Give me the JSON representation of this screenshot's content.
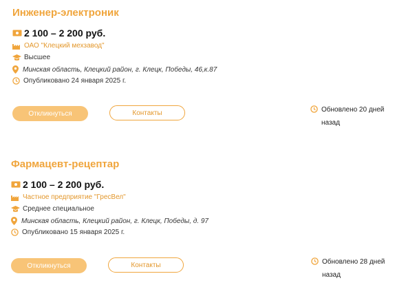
{
  "colors": {
    "accent": "#f0a53c",
    "link": "#e3972b",
    "button_fill": "#f8c477"
  },
  "vacancies": [
    {
      "title": "Инженер-электроник",
      "salary": "2 100 – 2 200 руб.",
      "company": "ОАО \"Клецкий мехзавод\"",
      "education": "Высшее",
      "address": "Минская область, Клецкий район, г. Клецк, Победы, 46,к.87",
      "published": "Опубликовано 24 января 2025 г.",
      "respond_label": "Откликнуться",
      "contacts_label": "Контакты",
      "updated": "Обновлено 20 дней назад"
    },
    {
      "title": "Фармацевт-рецептар",
      "salary": "2 100 – 2 200 руб.",
      "company": "Частное предприятие \"ГресВел\"",
      "education": "Среднее специальное",
      "address": "Минская область, Клецкий район, г. Клецк, Победы, д. 97",
      "published": "Опубликовано 15 января 2025 г.",
      "respond_label": "Откликнуться",
      "contacts_label": "Контакты",
      "updated": "Обновлено 28 дней назад"
    }
  ],
  "icons": {
    "salary": "banknote-icon",
    "company": "factory-icon",
    "education": "graduation-cap-icon",
    "address": "map-pin-icon",
    "published": "clock-icon",
    "updated": "clock-icon"
  }
}
